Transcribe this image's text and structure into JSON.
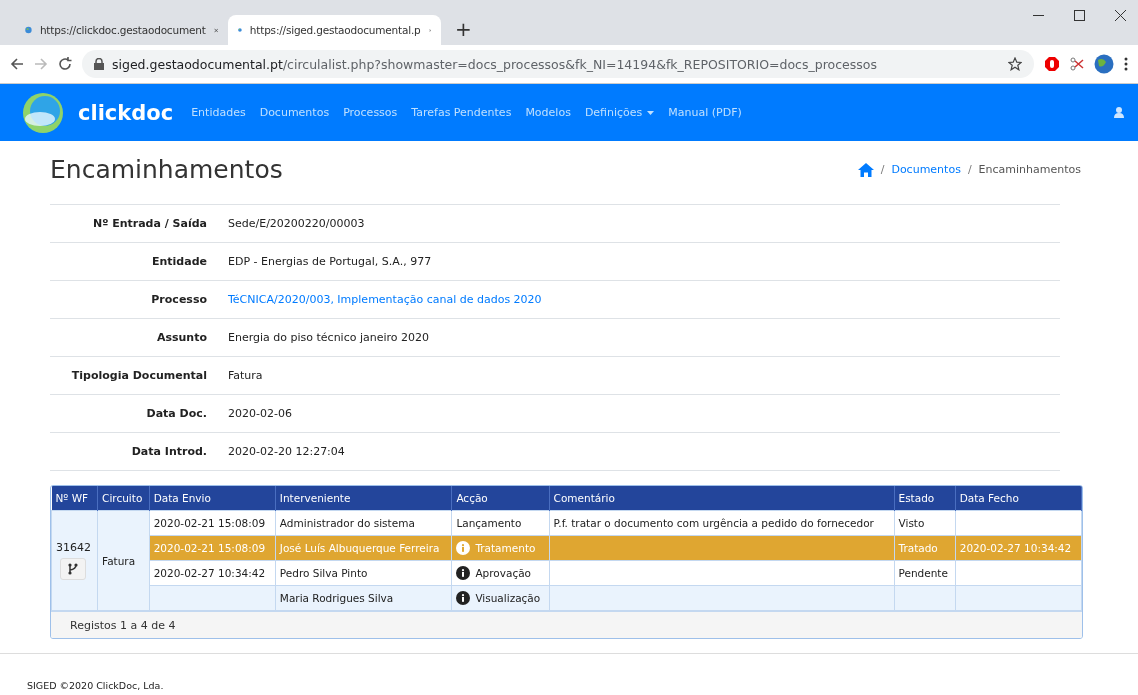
{
  "browser": {
    "tabs": [
      {
        "title": "https://clickdoc.gestaodocument",
        "selected": false
      },
      {
        "title": "https://siged.gestaodocumental.p",
        "selected": true
      }
    ],
    "new_tab": "+",
    "url_host": "siged.gestaodocumental.pt",
    "url_path": "/circulalist.php?showmaster=docs_processos&fk_NI=14194&fk_REPOSITORIO=docs_processos"
  },
  "navbar": {
    "brand": "clickdoc",
    "items": [
      {
        "label": "Entidades",
        "dropdown": false
      },
      {
        "label": "Documentos",
        "dropdown": false
      },
      {
        "label": "Processos",
        "dropdown": false
      },
      {
        "label": "Tarefas Pendentes",
        "dropdown": false
      },
      {
        "label": "Modelos",
        "dropdown": false
      },
      {
        "label": "Definições",
        "dropdown": true
      },
      {
        "label": "Manual (PDF)",
        "dropdown": false
      }
    ]
  },
  "page": {
    "title": "Encaminhamentos",
    "separator": "/",
    "breadcrumb": [
      {
        "label": "Documentos",
        "link": true
      },
      {
        "label": "Encaminhamentos",
        "link": false
      }
    ]
  },
  "details": [
    {
      "label": "Nº Entrada / Saída",
      "value": "Sede/E/20200220/00003",
      "link": false
    },
    {
      "label": "Entidade",
      "value": "EDP - Energias de Portugal, S.A., 977",
      "link": false
    },
    {
      "label": "Processo",
      "value": "TéCNICA/2020/003, Implementação canal de dados 2020",
      "link": true
    },
    {
      "label": "Assunto",
      "value": "Energia do piso técnico janeiro 2020",
      "link": false
    },
    {
      "label": "Tipologia Documental",
      "value": "Fatura",
      "link": false
    },
    {
      "label": "Data Doc.",
      "value": "2020-02-06",
      "link": false
    },
    {
      "label": "Data Introd.",
      "value": "2020-02-20 12:27:04",
      "link": false
    }
  ],
  "table": {
    "columns": [
      "Nº WF",
      "Circuito",
      "Data Envio",
      "Interveniente",
      "Acção",
      "Comentário",
      "Estado",
      "Data Fecho"
    ],
    "workflow": {
      "number": "31642",
      "circuit": "Fatura"
    },
    "rows": [
      {
        "data_envio": "2020-02-21 15:08:09",
        "interveniente": "Administrador do sistema",
        "accao": "Lançamento",
        "info": false,
        "comentario": "P.f. tratar o documento com urgência a pedido do fornecedor",
        "estado": "Visto",
        "data_fecho": "",
        "selected": false,
        "shaded": false
      },
      {
        "data_envio": "2020-02-21 15:08:09",
        "interveniente": "José Luís Albuquerque Ferreira",
        "accao": "Tratamento",
        "info": true,
        "comentario": "",
        "estado": "Tratado",
        "data_fecho": "2020-02-27 10:34:42",
        "selected": true,
        "shaded": false
      },
      {
        "data_envio": "2020-02-27 10:34:42",
        "interveniente": "Pedro Silva Pinto",
        "accao": "Aprovação",
        "info": true,
        "comentario": "",
        "estado": "Pendente",
        "data_fecho": "",
        "selected": false,
        "shaded": false
      },
      {
        "data_envio": "",
        "interveniente": "Maria Rodrigues Silva",
        "accao": "Visualização",
        "info": true,
        "comentario": "",
        "estado": "",
        "data_fecho": "",
        "selected": false,
        "shaded": true
      }
    ],
    "footer": "Registos 1 a 4 de 4"
  },
  "footer": "SIGED ©2020 ClickDoc, Lda."
}
